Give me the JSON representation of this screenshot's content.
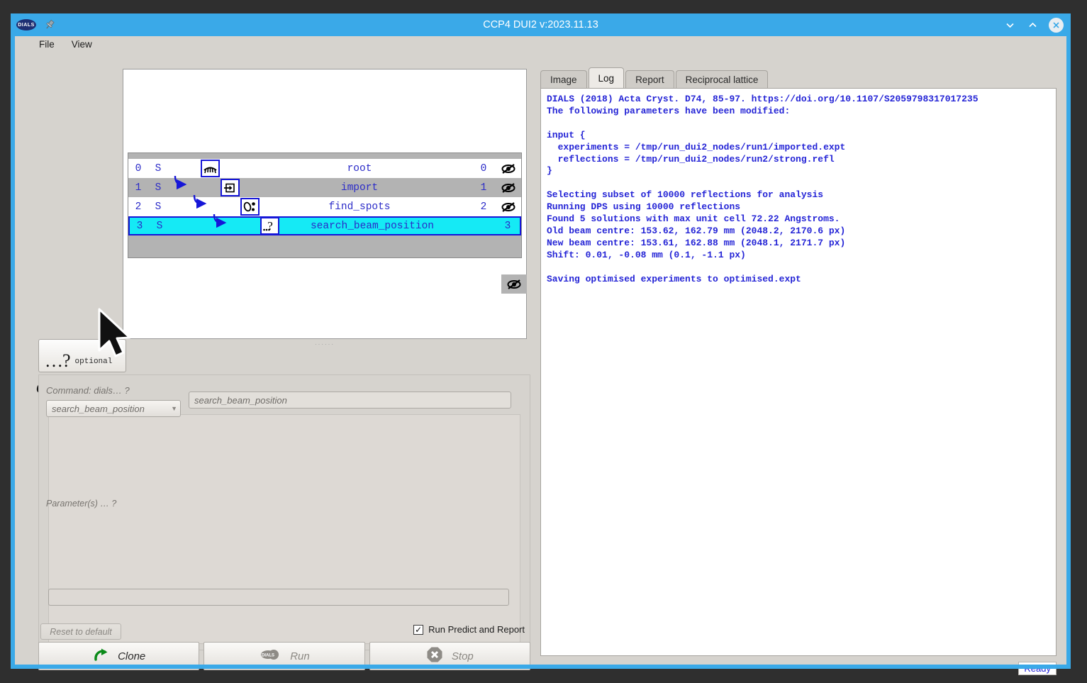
{
  "window": {
    "title": "CCP4 DUI2 v:2023.11.13",
    "logo_text": "DIALS",
    "pin_icon": "pushpin-icon",
    "minimize_icon": "chevron-down-icon",
    "maximize_icon": "chevron-up-icon",
    "close_icon": "close-circle-icon",
    "accent_color": "#3aa9e8"
  },
  "menubar": {
    "items": [
      {
        "label": "File"
      },
      {
        "label": "View"
      }
    ]
  },
  "tree": {
    "rows": [
      {
        "index": "0",
        "status": "S",
        "name": "root",
        "num": "0",
        "icon": "eyelash-icon",
        "eye": "eye-slash-icon",
        "selected": false
      },
      {
        "index": "1",
        "status": "S",
        "name": "import",
        "num": "1",
        "icon": "import-icon",
        "eye": "eye-slash-icon",
        "selected": false
      },
      {
        "index": "2",
        "status": "S",
        "name": "find_spots",
        "num": "2",
        "icon": "find-spots-icon",
        "eye": "eye-slash-icon",
        "selected": false
      },
      {
        "index": "3",
        "status": "S",
        "name": "search_beam_position",
        "num": "3",
        "icon": "optional-icon",
        "eye": "eye-slash-icon",
        "selected": true
      }
    ],
    "selected_color": "#15eaf5",
    "text_color": "#2b2bc8"
  },
  "optional_button": {
    "glyph": "…?",
    "label": "optional",
    "icon": "question-dots-icon"
  },
  "pane": {
    "heading": "optional"
  },
  "command": {
    "label": "Command:  dials…  ?",
    "combo_value": "search_beam_position",
    "combo_arrow_icon": "chevron-down-icon",
    "field_value": "search_beam_position",
    "params_hint": "Parameter(s) … ?",
    "bottom_field_value": ""
  },
  "controls": {
    "reset_label": "Reset to default",
    "run_predict_label": "Run Predict and Report",
    "run_predict_checked": true,
    "checkbox_glyph": "✓",
    "buttons": [
      {
        "label": "Clone",
        "icon": "clone-arrow-icon",
        "disabled": false
      },
      {
        "label": "Run",
        "icon": "dials-run-icon",
        "disabled": true
      },
      {
        "label": "Stop",
        "icon": "stop-octagon-icon",
        "disabled": true
      }
    ]
  },
  "right": {
    "tabs": [
      {
        "label": "Image",
        "active": false
      },
      {
        "label": "Log",
        "active": true
      },
      {
        "label": "Report",
        "active": false
      },
      {
        "label": "Reciprocal lattice",
        "active": false
      }
    ],
    "log": "DIALS (2018) Acta Cryst. D74, 85-97. https://doi.org/10.1107/S2059798317017235\nThe following parameters have been modified:\n\ninput {\n  experiments = /tmp/run_dui2_nodes/run1/imported.expt\n  reflections = /tmp/run_dui2_nodes/run2/strong.refl\n}\n\nSelecting subset of 10000 reflections for analysis\nRunning DPS using 10000 reflections\nFound 5 solutions with max unit cell 72.22 Angstroms.\nOld beam centre: 153.62, 162.79 mm (2048.2, 2170.6 px)\nNew beam centre: 153.61, 162.88 mm (2048.1, 2171.7 px)\nShift: 0.01, -0.08 mm (0.1, -1.1 px)\n\nSaving optimised experiments to optimised.expt",
    "log_color": "#2424d6",
    "status": "Ready"
  }
}
